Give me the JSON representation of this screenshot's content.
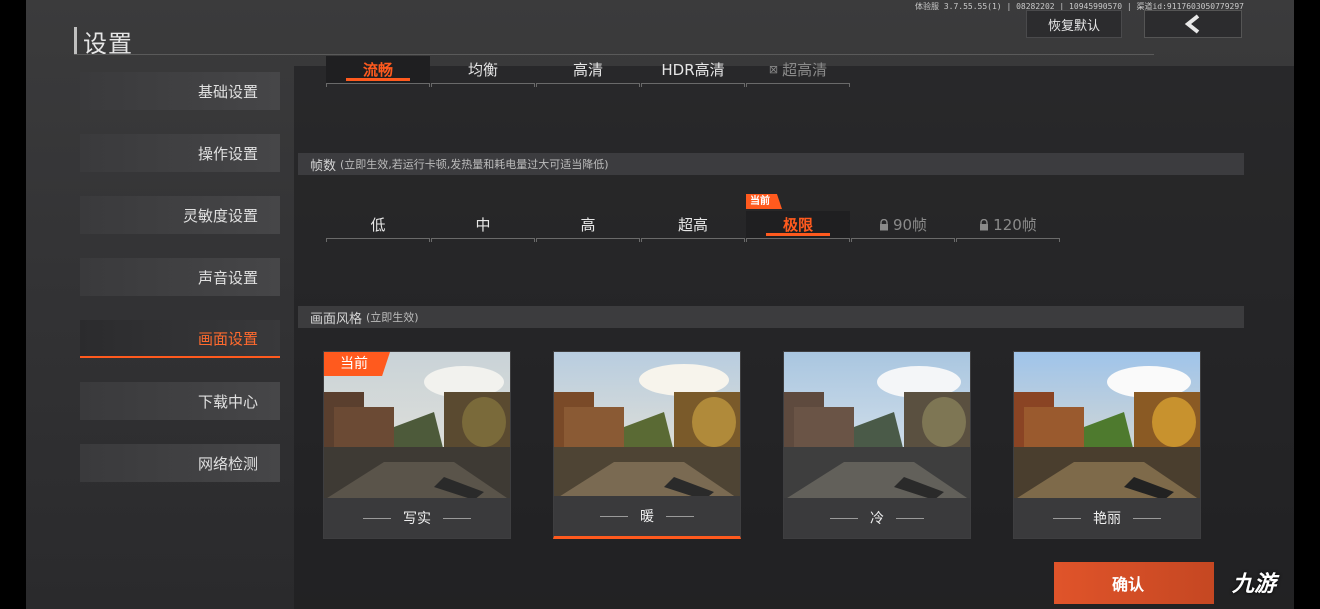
{
  "header": {
    "title": "设置",
    "version": "体验服 3.7.55.55(1) | 08282202 | 10945990570 | 渠道id:9117603050779297",
    "restore_label": "恢复默认"
  },
  "sidebar": {
    "items": [
      {
        "label": "基础设置"
      },
      {
        "label": "操作设置"
      },
      {
        "label": "灵敏度设置"
      },
      {
        "label": "声音设置"
      },
      {
        "label": "画面设置",
        "active": true
      },
      {
        "label": "下载中心"
      },
      {
        "label": "网络检测"
      }
    ]
  },
  "quality": {
    "options": [
      "流畅",
      "均衡",
      "高清",
      "HDR高清",
      "超高清"
    ]
  },
  "fps": {
    "title": "帧数",
    "subtitle": "(立即生效,若运行卡顿,发热量和耗电量过大可适当降低)",
    "current_tag": "当前",
    "options": [
      "低",
      "中",
      "高",
      "超高",
      "极限",
      "90帧",
      "120帧"
    ]
  },
  "style": {
    "title": "画面风格",
    "subtitle": "(立即生效)",
    "current_tag": "当前",
    "cards": [
      "写实",
      "暖",
      "冷",
      "艳丽"
    ]
  },
  "confirm_label": "确认",
  "watermark": "九游",
  "accent_color": "#ff5a1e"
}
